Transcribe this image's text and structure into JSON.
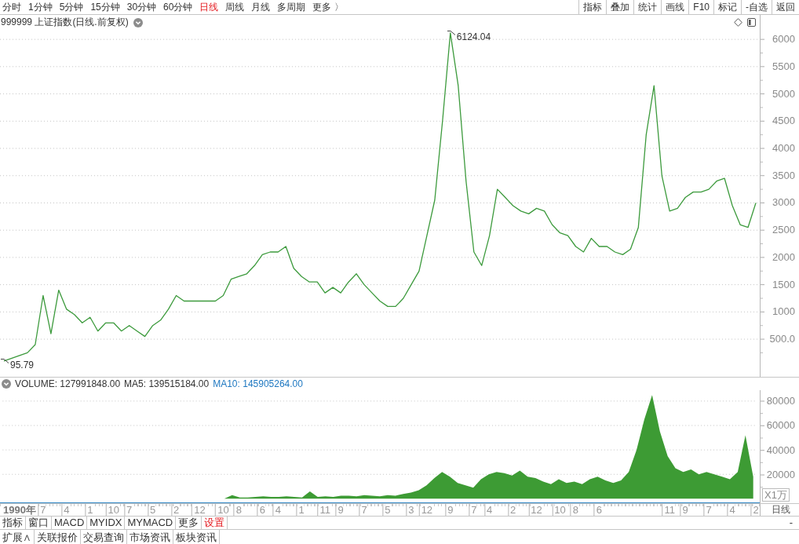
{
  "toolbar": {
    "periods": [
      {
        "label": "分时",
        "selected": false
      },
      {
        "label": "1分钟",
        "selected": false
      },
      {
        "label": "5分钟",
        "selected": false
      },
      {
        "label": "15分钟",
        "selected": false
      },
      {
        "label": "30分钟",
        "selected": false
      },
      {
        "label": "60分钟",
        "selected": false
      },
      {
        "label": "日线",
        "selected": true
      },
      {
        "label": "周线",
        "selected": false
      },
      {
        "label": "月线",
        "selected": false
      },
      {
        "label": "多周期",
        "selected": false
      },
      {
        "label": "更多 〉",
        "selected": false
      }
    ],
    "buttons": [
      "指标",
      "叠加",
      "统计",
      "画线",
      "F10",
      "标记",
      "-自选",
      "返回"
    ]
  },
  "price_panel": {
    "title": "999999 上证指数(日线.前复权)",
    "chart_data": {
      "type": "line",
      "grid": true,
      "ylim": [
        -190,
        6175
      ],
      "yticks": [
        {
          "value": 500,
          "label": "500.0"
        },
        1000,
        1500,
        2000,
        2500,
        3000,
        3500,
        4000,
        4500,
        5000,
        5500,
        6000
      ],
      "series": [
        {
          "color": "#3c9a3c",
          "values": [
            100,
            150,
            200,
            250,
            400,
            1300,
            600,
            1400,
            1050,
            950,
            800,
            900,
            650,
            800,
            800,
            650,
            750,
            650,
            550,
            750,
            850,
            1050,
            1300,
            1200,
            1200,
            1200,
            1200,
            1200,
            1300,
            1600,
            1650,
            1700,
            1850,
            2050,
            2100,
            2100,
            2200,
            1800,
            1650,
            1550,
            1550,
            1350,
            1450,
            1350,
            1550,
            1700,
            1500,
            1350,
            1200,
            1100,
            1100,
            1250,
            1500,
            1750,
            2400,
            3050,
            4500,
            6120,
            5150,
            3400,
            2100,
            1850,
            2400,
            3250,
            3100,
            2950,
            2850,
            2800,
            2900,
            2850,
            2600,
            2450,
            2400,
            2200,
            2100,
            2350,
            2200,
            2200,
            2100,
            2050,
            2150,
            2550,
            4250,
            5150,
            3500,
            2850,
            2900,
            3100,
            3200,
            3200,
            3250,
            3400,
            3450,
            2950,
            2600,
            2550,
            3000
          ]
        }
      ],
      "annotations": [
        "6124.04",
        "95.79"
      ]
    }
  },
  "volume_panel": {
    "indicators": [
      {
        "label": "VOLUME: 127991848.00",
        "color": "#333333"
      },
      {
        "label": "MA5: 139515184.00",
        "color": "#333333"
      },
      {
        "label": "MA10: 145905264.00",
        "color": "#1f78c1"
      }
    ],
    "chart_data": {
      "type": "area",
      "grid": true,
      "ylabel": "X1万",
      "categories": [
        null,
        null,
        "1990年",
        null,
        null,
        "7",
        null,
        null,
        "4",
        null,
        null,
        "1",
        null,
        null,
        "10",
        null,
        "7",
        null,
        null,
        "5",
        null,
        null,
        "2",
        null,
        null,
        "12",
        null,
        null,
        "10",
        null,
        "8",
        null,
        null,
        "6",
        null,
        "4",
        null,
        null,
        "1",
        null,
        null,
        "11",
        null,
        "9",
        null,
        null,
        "7",
        null,
        null,
        "5",
        null,
        null,
        "3",
        null,
        "12",
        null,
        null,
        "9",
        null,
        null,
        "7",
        null,
        "4",
        null,
        null,
        "2",
        null,
        null,
        "12",
        null,
        null,
        "10",
        null,
        "8",
        null,
        null,
        "6",
        null,
        null,
        null,
        null,
        null,
        null,
        null,
        null,
        "11",
        null,
        "9",
        null,
        null,
        "7",
        null,
        null,
        "4",
        null,
        null,
        "2"
      ],
      "ylim": [
        -2980,
        88940
      ],
      "yticks": [
        20000,
        40000,
        60000,
        80000
      ],
      "series": [
        {
          "color": "#3d9b34",
          "values": [
            0,
            0,
            0,
            0,
            0,
            0,
            0,
            0,
            0,
            0,
            0,
            0,
            0,
            0,
            0,
            0,
            0,
            0,
            0,
            0,
            0,
            0,
            0,
            0,
            0,
            0,
            0,
            0,
            0,
            3000,
            1000,
            1000,
            1500,
            2000,
            1500,
            1500,
            2000,
            1500,
            1000,
            6000,
            1500,
            2000,
            1500,
            2500,
            2500,
            2000,
            3000,
            2500,
            2000,
            3000,
            2500,
            4000,
            5000,
            7000,
            11000,
            17000,
            22000,
            18000,
            13000,
            11000,
            9000,
            16000,
            20000,
            22000,
            21000,
            19000,
            23000,
            18000,
            17000,
            14000,
            12000,
            16000,
            13000,
            14000,
            12000,
            16000,
            18000,
            15000,
            13000,
            15000,
            22000,
            40000,
            65000,
            85000,
            55000,
            35000,
            25000,
            22000,
            24000,
            20000,
            22000,
            20000,
            18000,
            16000,
            22000,
            52000,
            18000
          ]
        }
      ]
    },
    "period_label": "日线"
  },
  "indicator_tabs": [
    {
      "label": "指标",
      "highlighted": false
    },
    {
      "label": "窗口",
      "highlighted": false
    },
    {
      "label": "MACD",
      "highlighted": false
    },
    {
      "label": "MYIDX",
      "highlighted": false
    },
    {
      "label": "MYMACD",
      "highlighted": false
    },
    {
      "label": "更多",
      "highlighted": false
    },
    {
      "label": "设置",
      "highlighted": true
    }
  ],
  "indicator_bar_end": "-",
  "bottom_tabs": [
    "扩展∧",
    "关联报价",
    "交易查询",
    "市场资讯",
    "板块资讯"
  ]
}
